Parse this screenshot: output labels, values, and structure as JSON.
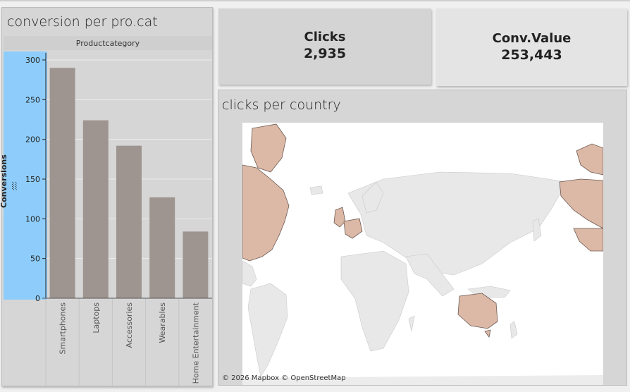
{
  "left_panel": {
    "title": "conversion per pro.cat"
  },
  "chart_data": {
    "type": "bar",
    "title": "conversion per pro.cat",
    "header": "Productcategory",
    "ylabel": "Conversions",
    "xlabel": "",
    "categories": [
      "Smartphones",
      "Laptops",
      "Accessories",
      "Wearables",
      "Home Entertainment"
    ],
    "values": [
      290,
      224,
      192,
      127,
      84
    ],
    "ylim": [
      0,
      300
    ],
    "yticks": [
      0,
      50,
      100,
      150,
      200,
      250,
      300
    ],
    "grid": true,
    "bar_color": "#9e9590"
  },
  "kpis": {
    "clicks": {
      "label": "Clicks",
      "value": "2,935"
    },
    "conv_value": {
      "label": "Conv.Value",
      "value": "253,443"
    }
  },
  "map_panel": {
    "title": "clicks per country",
    "credit": "© 2026 Mapbox © OpenStreetMap",
    "highlight_color": "#dcb8a6",
    "land_color": "#e6e6e6"
  },
  "colors": {
    "axis_band": "#8ecdfb",
    "panel_bg": "#d6d6d6"
  }
}
